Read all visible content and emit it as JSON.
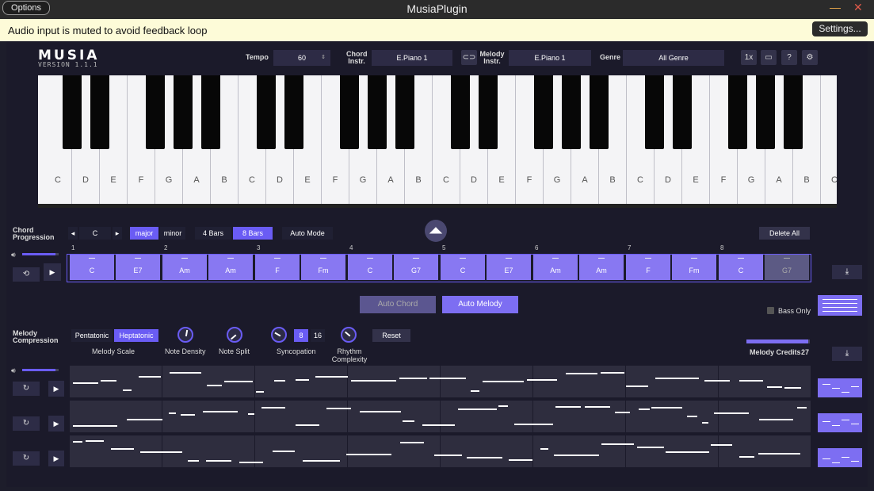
{
  "window": {
    "options_label": "Options",
    "title": "MusiaPlugin",
    "minimize": "—",
    "close": "✕"
  },
  "banner": {
    "message": "Audio input is muted to avoid feedback loop",
    "settings_label": "Settings..."
  },
  "app": {
    "logo": "MUSIA",
    "version": "VERSION 1.1.1"
  },
  "toolbar": {
    "tempo_label": "Tempo",
    "tempo_value": "60",
    "chord_instr_label_1": "Chord",
    "chord_instr_label_2": "Instr.",
    "chord_instr_value": "E.Piano 1",
    "melody_instr_label_1": "Melody",
    "melody_instr_label_2": "Instr.",
    "melody_instr_value": "E.Piano 1",
    "genre_label": "Genre",
    "genre_value": "All Genre",
    "speed_label": "1x",
    "help_label": "?"
  },
  "piano": {
    "white_keys": [
      "C",
      "D",
      "E",
      "F",
      "G",
      "A",
      "B",
      "C",
      "D",
      "E",
      "F",
      "G",
      "A",
      "B",
      "C",
      "D",
      "E",
      "F",
      "G",
      "A",
      "B",
      "C",
      "D",
      "E",
      "F",
      "G",
      "A",
      "B",
      "C"
    ]
  },
  "chord_progression": {
    "label_1": "Chord",
    "label_2": "Progression",
    "key": "C",
    "major": "major",
    "minor": "minor",
    "bars_4": "4 Bars",
    "bars_8": "8 Bars",
    "auto_mode": "Auto Mode",
    "delete_all": "Delete All",
    "bar_numbers": [
      "1",
      "2",
      "3",
      "4",
      "5",
      "6",
      "7",
      "8"
    ],
    "chords": [
      "C",
      "E7",
      "Am",
      "Am",
      "F",
      "Fm",
      "C",
      "G7",
      "C",
      "E7",
      "Am",
      "Am",
      "F",
      "Fm",
      "C",
      "G7"
    ]
  },
  "actions": {
    "auto_chord": "Auto Chord",
    "auto_melody": "Auto Melody",
    "bass_only": "Bass Only"
  },
  "melody": {
    "label_1": "Melody",
    "label_2": "Compression",
    "pentatonic": "Pentatonic",
    "heptatonic": "Heptatonic",
    "scale_label": "Melody Scale",
    "note_density": "Note Density",
    "note_split": "Note Split",
    "syncopation": "Syncopation",
    "sync_8": "8",
    "sync_16": "16",
    "rhythm_1": "Rhythm",
    "rhythm_2": "Complexity",
    "reset": "Reset",
    "credits_label": "Melody Credits",
    "credits_value": "27",
    "credits_fraction": 0.97
  },
  "colors": {
    "accent": "#6a5cf4",
    "chord_fill": "#8878f2",
    "panel_bg": "#1b1a2a"
  }
}
